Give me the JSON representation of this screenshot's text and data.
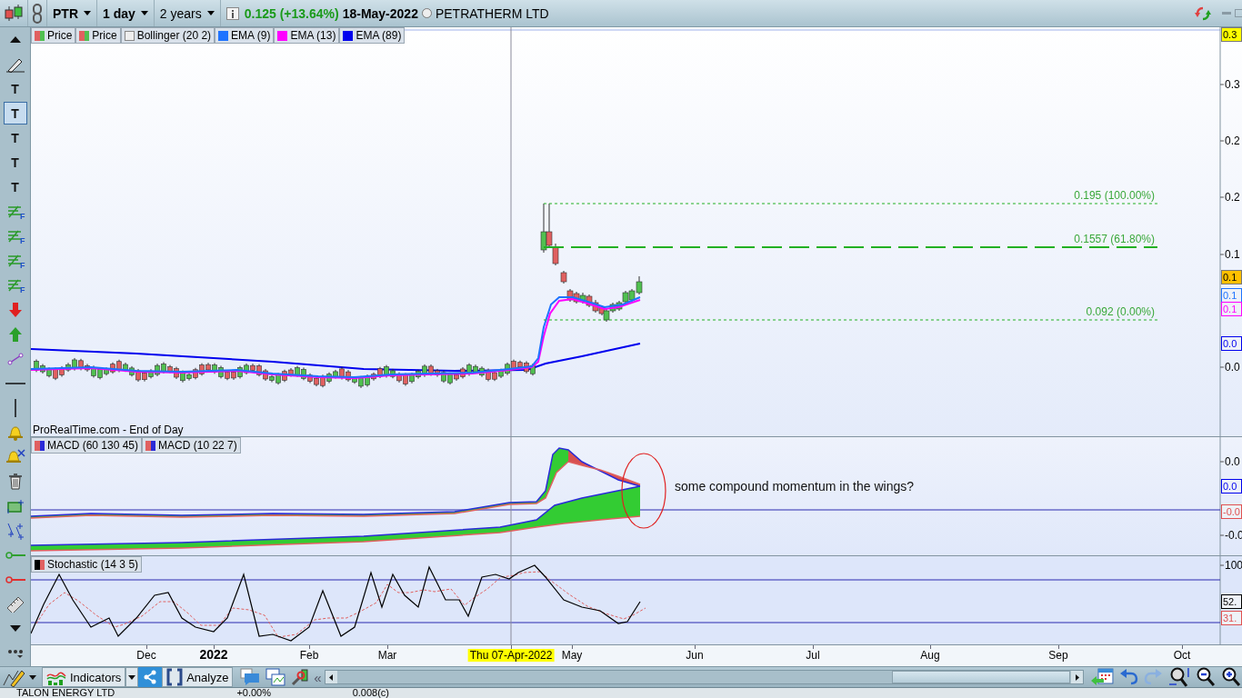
{
  "toolbar": {
    "symbol": "PTR",
    "interval": "1 day",
    "range": "2 years",
    "quote": "0.125 (+13.64%)",
    "date": "18-May-2022",
    "company": "PETRATHERM LTD",
    "company_selected": false
  },
  "left_tools": [
    {
      "kind": "collapse",
      "selected": false
    },
    {
      "kind": "pencil",
      "selected": false
    },
    {
      "kind": "text",
      "glyph": "T",
      "selected": false
    },
    {
      "kind": "text",
      "glyph": "T",
      "selected": true
    },
    {
      "kind": "text",
      "glyph": "T",
      "selected": false
    },
    {
      "kind": "text",
      "glyph": "T",
      "selected": false
    },
    {
      "kind": "text",
      "glyph": "T",
      "selected": false
    },
    {
      "kind": "fib",
      "glyph": "F",
      "selected": false
    },
    {
      "kind": "fib",
      "glyph": "F",
      "selected": false
    },
    {
      "kind": "fib",
      "glyph": "F",
      "selected": false
    },
    {
      "kind": "fib",
      "glyph": "F",
      "selected": false
    },
    {
      "kind": "arrow-down",
      "selected": false
    },
    {
      "kind": "arrow-up",
      "selected": false
    },
    {
      "kind": "segment",
      "selected": false
    },
    {
      "kind": "hline",
      "selected": false
    },
    {
      "kind": "vline",
      "selected": false
    },
    {
      "kind": "bell",
      "selected": false
    },
    {
      "kind": "bell-off",
      "selected": false
    },
    {
      "kind": "trash",
      "selected": false
    },
    {
      "kind": "rect",
      "selected": false
    },
    {
      "kind": "points",
      "selected": false
    },
    {
      "kind": "ray",
      "color": "#30a030",
      "selected": false
    },
    {
      "kind": "ray",
      "color": "#e03030",
      "selected": false
    },
    {
      "kind": "ruler",
      "selected": false
    },
    {
      "kind": "scroll-down",
      "selected": false
    },
    {
      "kind": "more",
      "selected": false
    }
  ],
  "price_panel": {
    "legend": [
      {
        "label": "Price",
        "kind": "candle"
      },
      {
        "label": "Price",
        "kind": "candle"
      },
      {
        "label": "Bollinger (20 2)",
        "kind": "empty"
      },
      {
        "label": "EMA (9)",
        "kind": "line",
        "color": "#1e73ff"
      },
      {
        "label": "EMA (13)",
        "kind": "line",
        "color": "#ff00ff"
      },
      {
        "label": "EMA (89)",
        "kind": "line",
        "color": "#0000ee"
      }
    ],
    "fib_levels": [
      {
        "label": "0.195 (100.00%)",
        "kind": "dotted"
      },
      {
        "label": "0.1557 (61.80%)",
        "kind": "dashed"
      },
      {
        "label": "0.092 (0.00%)",
        "kind": "dotted"
      }
    ],
    "source": "ProRealTime.com - End of Day",
    "axis_labels": [
      {
        "text": "0.3",
        "kind": "marker",
        "color": "#ffff00"
      },
      {
        "text": "0.3",
        "kind": "tick"
      },
      {
        "text": "0.2",
        "kind": "tick"
      },
      {
        "text": "0.2",
        "kind": "tick"
      },
      {
        "text": "0.1",
        "kind": "tick"
      },
      {
        "text": "0.1",
        "kind": "marker",
        "color": "#ffc000"
      },
      {
        "text": "0.1",
        "kind": "value",
        "color": "#1e73ff"
      },
      {
        "text": "0.1",
        "kind": "value",
        "color": "#ff00ff"
      },
      {
        "text": "0.0",
        "kind": "value",
        "color": "#0000ee"
      },
      {
        "text": "0.0",
        "kind": "tick"
      }
    ]
  },
  "macd_panel": {
    "legend": [
      {
        "label": "MACD (60 130 45)",
        "kind": "pair"
      },
      {
        "label": "MACD (10 22 7)",
        "kind": "pair"
      }
    ],
    "annotation": "some compound momentum in the wings?",
    "axis_labels": [
      {
        "text": "0.0",
        "kind": "tick"
      },
      {
        "text": "0.0",
        "kind": "value",
        "color": "#0000ee"
      },
      {
        "text": "-0.0",
        "kind": "value",
        "color": "#e05050"
      },
      {
        "text": "-0.0",
        "kind": "tick"
      }
    ]
  },
  "stochastic_panel": {
    "legend": [
      {
        "label": "Stochastic (14 3 5)",
        "kind": "stochastic"
      }
    ],
    "axis_labels": [
      {
        "text": "100",
        "kind": "tick"
      },
      {
        "text": "52.",
        "kind": "value",
        "color": "#000000"
      },
      {
        "text": "31.",
        "kind": "value",
        "color": "#e05050"
      }
    ]
  },
  "x_axis": [
    {
      "text": "Dec",
      "kind": "month"
    },
    {
      "text": "2022",
      "kind": "year"
    },
    {
      "text": "Feb",
      "kind": "month"
    },
    {
      "text": "Mar",
      "kind": "month"
    },
    {
      "text": "Thu 07-Apr-2022",
      "kind": "cursor"
    },
    {
      "text": "May",
      "kind": "month"
    },
    {
      "text": "Jun",
      "kind": "month"
    },
    {
      "text": "Jul",
      "kind": "month"
    },
    {
      "text": "Aug",
      "kind": "month"
    },
    {
      "text": "Sep",
      "kind": "month"
    },
    {
      "text": "Oct",
      "kind": "month"
    }
  ],
  "bottom_toolbar": {
    "indicators": "Indicators",
    "analyze": "Analyze",
    "collapse": "«"
  },
  "watchlist_row": {
    "name": "TALON ENERGY LTD",
    "change": "+0.00%",
    "price": "0.008(c)"
  }
}
